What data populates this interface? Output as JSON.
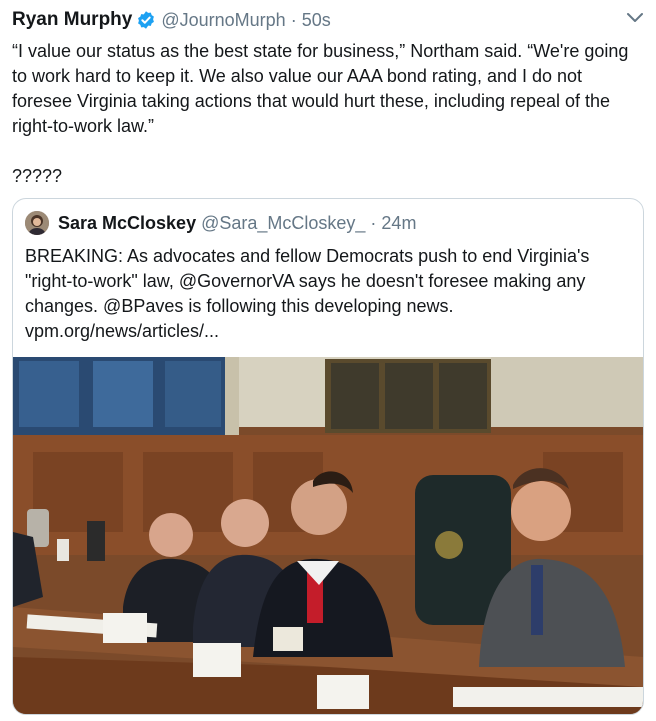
{
  "tweet": {
    "name": "Ryan Murphy",
    "handle": "@JournoMurph",
    "separator": "·",
    "time": "50s",
    "text": "“I value our status as the best state for business,” Northam said. “We're going to work hard to keep it. We also value our AAA bond rating, and I do not foresee Virginia taking actions that would hurt these, including repeal of the right-to-work law.”\n\n?????"
  },
  "quoted": {
    "name": "Sara McCloskey",
    "handle": "@Sara_McCloskey_",
    "separator": "·",
    "time": "24m",
    "text": "BREAKING: As advocates and fellow Democrats push to end Virginia's \"right-to-work\" law, @GovernorVA says he doesn't foresee making any changes. @BPaves is following this developing news. vpm.org/news/articles/..."
  },
  "colors": {
    "text": "#14171a",
    "secondary": "#657786",
    "verified": "#1da1f2",
    "border": "#ccd6dd"
  },
  "icons": [
    "verified-badge-icon",
    "chevron-down-icon"
  ]
}
